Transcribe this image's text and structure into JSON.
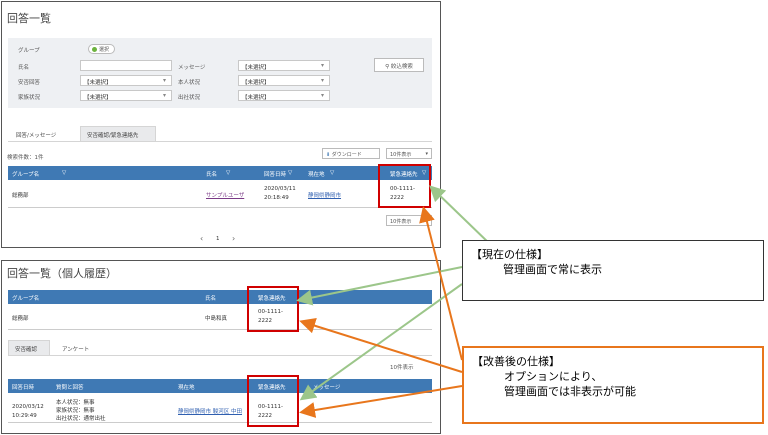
{
  "panel1": {
    "title": "回答一覧",
    "filter": {
      "group_label": "グループ",
      "select_button": "選択",
      "name_label": "氏名",
      "message_label": "メッセージ",
      "message_value": "【未選択】",
      "safety_label": "安否回答",
      "safety_value": "【未選択】",
      "person_label": "本人状況",
      "person_value": "【未選択】",
      "family_label": "家族状況",
      "family_value": "【未選択】",
      "office_label": "出社状況",
      "office_value": "【未選択】",
      "search_button": "絞込検索"
    },
    "tabs": [
      "回答/メッセージ",
      "安否確認/緊急連絡先"
    ],
    "toolbar": {
      "count": "検索件数：1件",
      "download": "ダウンロード",
      "perpage": "10件表示"
    },
    "table": {
      "headers": [
        "グループ名",
        "氏名",
        "回答日時",
        "現在地",
        "緊急連絡先"
      ],
      "row": {
        "group": "総務部",
        "name": "サンプルユーザ",
        "date": "2020/03/11",
        "time": "20:18:49",
        "location": "静岡県静岡市",
        "phone1": "00-1111-",
        "phone2": "2222"
      }
    },
    "perpage_bottom": "10件表示",
    "pager": {
      "prev": "‹",
      "page": "1",
      "next": "›"
    }
  },
  "panel2": {
    "title": "回答一覧（個人履歴）",
    "table1": {
      "headers": [
        "グループ名",
        "氏名",
        "緊急連絡先"
      ],
      "row": {
        "group": "総務部",
        "name": "中島和真",
        "phone1": "00-1111-",
        "phone2": "2222"
      }
    },
    "tabs": [
      "安否確認",
      "アンケート"
    ],
    "perpage": "10件表示",
    "table2": {
      "headers": [
        "回答日時",
        "質問と回答",
        "現在地",
        "緊急連絡先",
        "メッセージ"
      ],
      "row": {
        "date": "2020/03/12",
        "time": "10:29:49",
        "a1": "本人状況：無事",
        "a2": "家族状況：無事",
        "a3": "出社状況：通常出社",
        "location": "静岡県静岡市 駿河区 中田",
        "phone1": "00-1111-",
        "phone2": "2222"
      }
    }
  },
  "callout1": {
    "title": "【現在の仕様】",
    "body": "管理画面で常に表示"
  },
  "callout2": {
    "title": "【改善後の仕様】",
    "line1": "オプションにより、",
    "line2": "管理画面では非表示が可能"
  },
  "colors": {
    "header_blue": "#3f79b4",
    "red": "#d00000",
    "green_arrow": "#9cc68a",
    "orange_arrow": "#e8761c"
  }
}
